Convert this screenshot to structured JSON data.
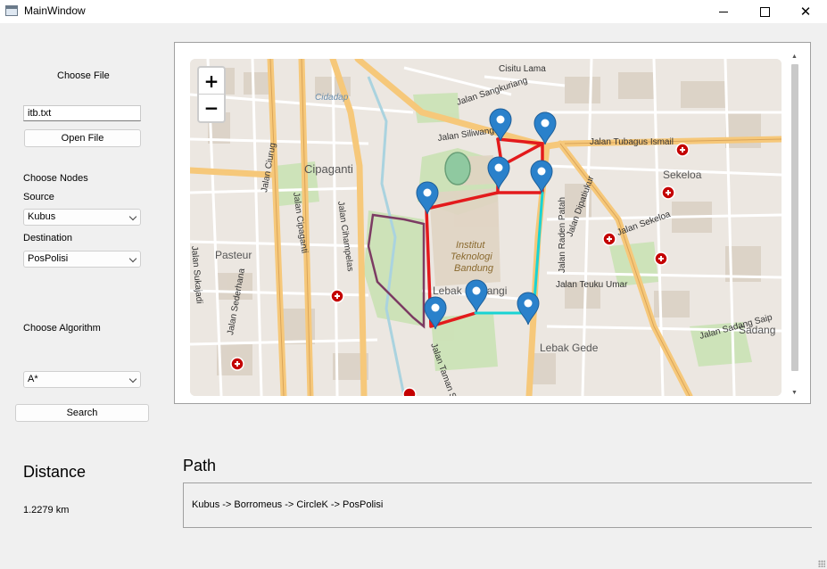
{
  "window": {
    "title": "MainWindow",
    "min_icon": "minimize-icon",
    "max_icon": "maximize-icon",
    "close_icon": "close-icon",
    "close_glyph": "✕"
  },
  "sidebar": {
    "choose_file_label": "Choose File",
    "file_input_value": "itb.txt",
    "open_file_button": "Open File",
    "choose_nodes_label": "Choose Nodes",
    "source_label": "Source",
    "source_value": "Kubus",
    "destination_label": "Destination",
    "destination_value": "PosPolisi",
    "choose_algorithm_label": "Choose Algorithm",
    "algorithm_value": "A*",
    "search_button": "Search"
  },
  "map": {
    "zoom_in": "+",
    "zoom_out": "−",
    "place_labels": [
      "Cisitu Lama",
      "Cipaganti",
      "Sekeloa",
      "Pasteur",
      "Institut",
      "Teknologi",
      "Bandung",
      "Lebak Siliwangi",
      "Lebak Gede",
      "Sadang"
    ],
    "street_labels": [
      "Jalan Siliwangi",
      "Jalan Tubagus Ismail",
      "Jalan Dipatiukur",
      "Jalan Cipaganti",
      "Jalan Cihampelas",
      "Jalan Sukajadi",
      "Jalan Sederhana",
      "Jalan Taman Sari",
      "Jalan Teuku Umar",
      "Jalan Sekeloa",
      "Jalan Sadang Saip",
      "Jalan Ciurug",
      "Jalan Raden Patah",
      "Jalan Sangkuriang",
      "Cidadap"
    ],
    "colors": {
      "route_red": "#e31a1c",
      "route_cyan": "#19d3d3",
      "marker_blue": "#2a81cb",
      "campus_outline": "#7c3b63",
      "major_road": "#f6c87a",
      "hospital_red": "#c40000"
    }
  },
  "results": {
    "distance_heading": "Distance",
    "distance_value": "1.2279 km",
    "path_heading": "Path",
    "path_value": "Kubus -> Borromeus -> CircleK -> PosPolisi"
  }
}
